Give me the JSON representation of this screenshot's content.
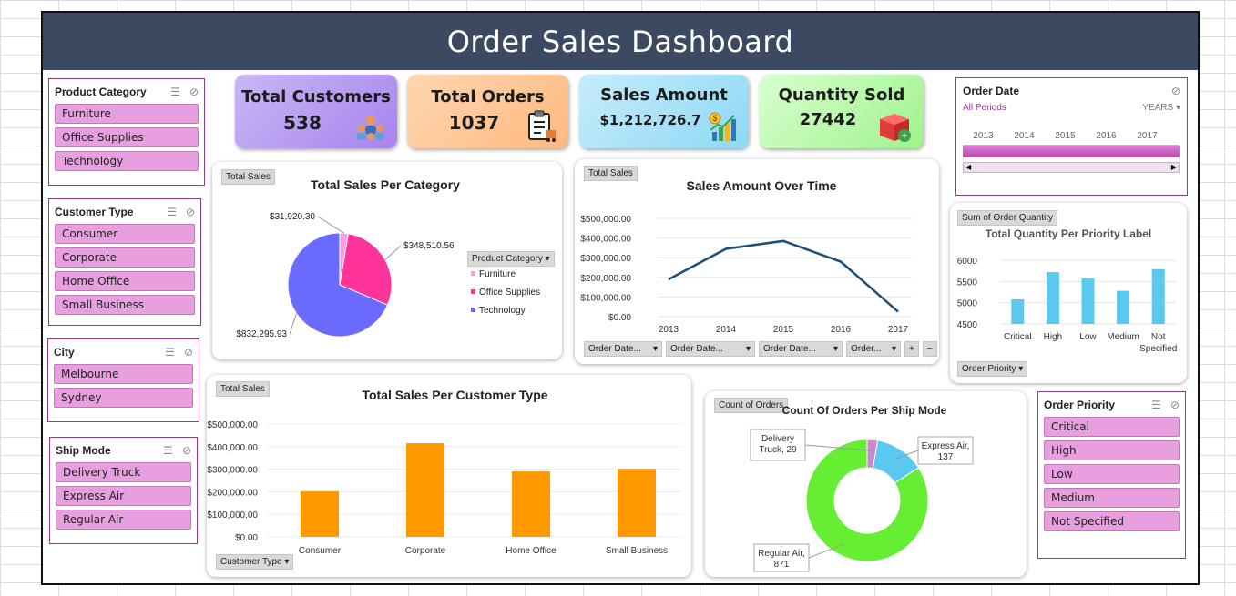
{
  "title": "Order Sales Dashboard",
  "slicers": {
    "product_category": {
      "title": "Product Category",
      "items": [
        "Furniture",
        "Office Supplies",
        "Technology"
      ]
    },
    "customer_type": {
      "title": "Customer Type",
      "items": [
        "Consumer",
        "Corporate",
        "Home Office",
        "Small Business"
      ]
    },
    "city": {
      "title": "City",
      "items": [
        "Melbourne",
        "Sydney"
      ]
    },
    "ship_mode": {
      "title": "Ship Mode",
      "items": [
        "Delivery Truck",
        "Express Air",
        "Regular Air"
      ]
    },
    "order_priority": {
      "title": "Order Priority",
      "items": [
        "Critical",
        "High",
        "Low",
        "Medium",
        "Not Specified"
      ]
    }
  },
  "kpis": {
    "customers": {
      "label": "Total Customers",
      "value": "538",
      "icon": "customers-icon"
    },
    "orders": {
      "label": "Total Orders",
      "value": "1037",
      "icon": "clipboard-icon"
    },
    "sales": {
      "label": "Sales Amount",
      "value": "$1,212,726.7",
      "icon": "money-chart-icon"
    },
    "quantity": {
      "label": "Quantity Sold",
      "value": "27442",
      "icon": "box-icon"
    }
  },
  "timeline": {
    "title": "Order Date",
    "periods": "All Periods",
    "unit": "YEARS",
    "years": [
      "2013",
      "2014",
      "2015",
      "2016",
      "2017"
    ]
  },
  "colors": {
    "furniture": "#f6a0e0",
    "office": "#ff3399",
    "technology": "#6b6bff",
    "line": "#1f4e79",
    "bar_orange": "#ff9900",
    "bar_blue": "#5bc8f0",
    "donut_green": "#66ee33",
    "donut_blue": "#5bc8f0",
    "donut_pink": "#cc88cc"
  },
  "charts": {
    "category": {
      "field": "Total Sales",
      "title": "Total Sales Per Category",
      "legend_field": "Product Category",
      "labels": [
        "$31,920.30",
        "$348,510.56",
        "$832,295.93"
      ]
    },
    "over_time": {
      "field": "Total Sales",
      "title": "Sales Amount Over Time",
      "ticks": [
        "$500,000.00",
        "$400,000.00",
        "$300,000.00",
        "$200,000.00",
        "$100,000.00",
        "$0.00"
      ],
      "filters": [
        "Order Date...",
        "Order Date...",
        "Order Date...",
        "Order..."
      ]
    },
    "priority": {
      "field": "Sum of Order Quantity",
      "title": "Total Quantity Per Priority Label",
      "ticks": [
        "6000",
        "5500",
        "5000",
        "4500"
      ],
      "filter": "Order Priority"
    },
    "customer_type": {
      "field": "Total  Sales",
      "title": "Total Sales Per Customer Type",
      "ticks": [
        "$500,000.00",
        "$400,000.00",
        "$300,000.00",
        "$200,000.00",
        "$100,000.00",
        "$0.00"
      ],
      "filter": "Customer Type"
    },
    "ship_mode": {
      "field": "Count of Orders",
      "title": "Count Of Orders Per Ship Mode",
      "callouts": [
        "Delivery Truck, 29",
        "Express Air, 137",
        "Regular Air, 871"
      ]
    }
  },
  "chart_data": [
    {
      "type": "pie",
      "title": "Total Sales Per Category",
      "categories": [
        "Furniture",
        "Office Supplies",
        "Technology"
      ],
      "values": [
        31920.3,
        348510.56,
        832295.93
      ]
    },
    {
      "type": "line",
      "title": "Sales Amount Over Time",
      "x": [
        "2013",
        "2014",
        "2015",
        "2016",
        "2017"
      ],
      "values": [
        190000,
        345000,
        385000,
        280000,
        25000
      ],
      "ylim": [
        0,
        500000
      ]
    },
    {
      "type": "bar",
      "title": "Total Quantity Per Priority Label",
      "categories": [
        "Critical",
        "High",
        "Low",
        "Medium",
        "Not Specified"
      ],
      "values": [
        5080,
        5720,
        5570,
        5280,
        5790
      ],
      "ylim": [
        4500,
        6000
      ]
    },
    {
      "type": "bar",
      "title": "Total Sales Per Customer Type",
      "categories": [
        "Consumer",
        "Corporate",
        "Home Office",
        "Small Business"
      ],
      "values": [
        202000,
        415000,
        290000,
        302000
      ],
      "ylim": [
        0,
        500000
      ]
    },
    {
      "type": "pie",
      "title": "Count Of Orders Per Ship Mode",
      "categories": [
        "Delivery Truck",
        "Express Air",
        "Regular Air"
      ],
      "values": [
        29,
        137,
        871
      ]
    }
  ]
}
